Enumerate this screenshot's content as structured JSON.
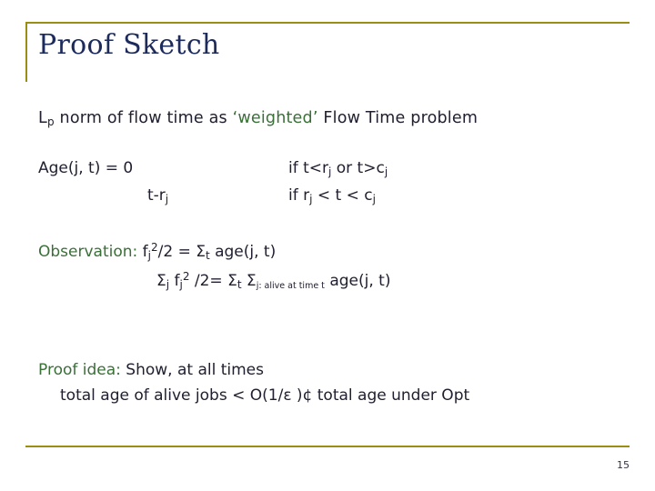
{
  "slide": {
    "title": "Proof Sketch",
    "page_number": "15",
    "accent_color": "#9a8e12",
    "title_color": "#1d2b5c",
    "highlight_color": "#3a6f38",
    "line1": {
      "before": "L",
      "sub": "p",
      "mid": " norm of flow time  as  ",
      "highlight": "‘weighted’",
      "after": " Flow Time problem"
    },
    "age_definition": {
      "left_line1": "Age(j, t) =  0",
      "left_line2": "t-r",
      "left_line2_sub": "j",
      "right_line1_a": "if   t<r",
      "right_line1_sub1": "j",
      "right_line1_b": "  or   t>c",
      "right_line1_sub2": "j",
      "right_line2_a": "if   r",
      "right_line2_sub1": "j",
      "right_line2_b": " < t < c",
      "right_line2_sub2": "j"
    },
    "observation": {
      "label": "Observation:",
      "line1_a": "  f",
      "line1_sub1": "j",
      "line1_sup": "2",
      "line1_b": "/2 =  Σ",
      "line1_sub2": "t",
      "line1_c": "  age(j, t)",
      "line2_a": "Σ",
      "line2_sub1": "j",
      "line2_b": "  f",
      "line2_sub2": "j",
      "line2_sup": "2",
      "line2_c": " /2= Σ",
      "line2_sub3": "t",
      "line2_d": "  Σ",
      "line2_sub4": "j: alive at time t",
      "line2_e": " age(j, t)"
    },
    "proof_idea": {
      "label": "Proof idea:",
      "line1": "  Show, at all times",
      "line2_a": "total age of alive jobs < O(1/",
      "line2_eps": "ε",
      "line2_b": " )¢ total age under Opt"
    }
  }
}
